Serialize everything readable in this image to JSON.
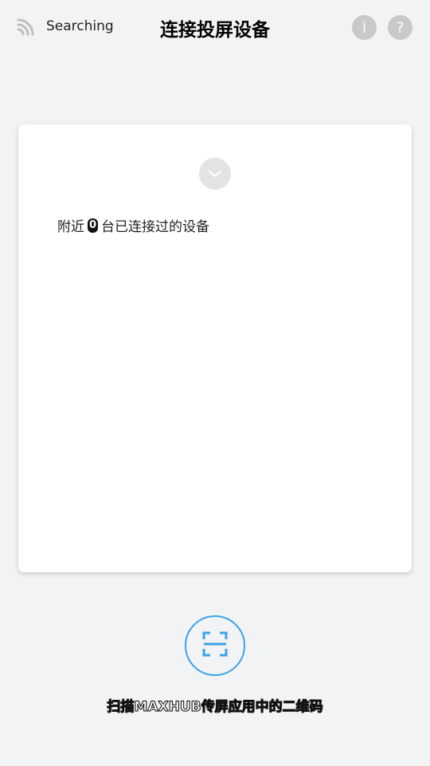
{
  "header": {
    "status_text": "Searching",
    "title": "连接投屏设备",
    "info_icon_label": "i",
    "help_icon_label": "?"
  },
  "card": {
    "nearby_prefix": "附近",
    "nearby_count": "0",
    "nearby_suffix": "台已连接过的设备"
  },
  "scan": {
    "label": "扫描MAXHUB传屏应用中的二维码"
  },
  "icons": {
    "status": "cast-icon",
    "info": "info-icon",
    "help": "help-icon",
    "expand": "chevron-down-icon",
    "scan": "scan-icon"
  },
  "colors": {
    "background": "#f2f3f5",
    "card": "#ffffff",
    "accent": "#3aa3e8",
    "icon_gray": "#c9c9c9"
  }
}
